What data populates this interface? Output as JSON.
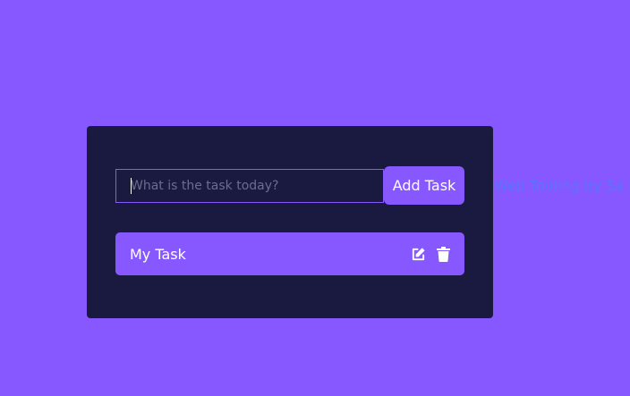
{
  "todo_form": {
    "input_placeholder": "What is the task today?",
    "input_value": "",
    "submit_label": "Add Task"
  },
  "todo_list": {
    "items": [
      {
        "text": "My Task",
        "actions": [
          "edit-icon",
          "trash-icon"
        ]
      }
    ]
  },
  "footer": {
    "credit_text": "Web Tooling by Sa"
  },
  "colors": {
    "page_background": "#8758ff",
    "card_background": "#1a1a40",
    "accent": "#8758ff",
    "credit_text": "#5a73ff"
  }
}
